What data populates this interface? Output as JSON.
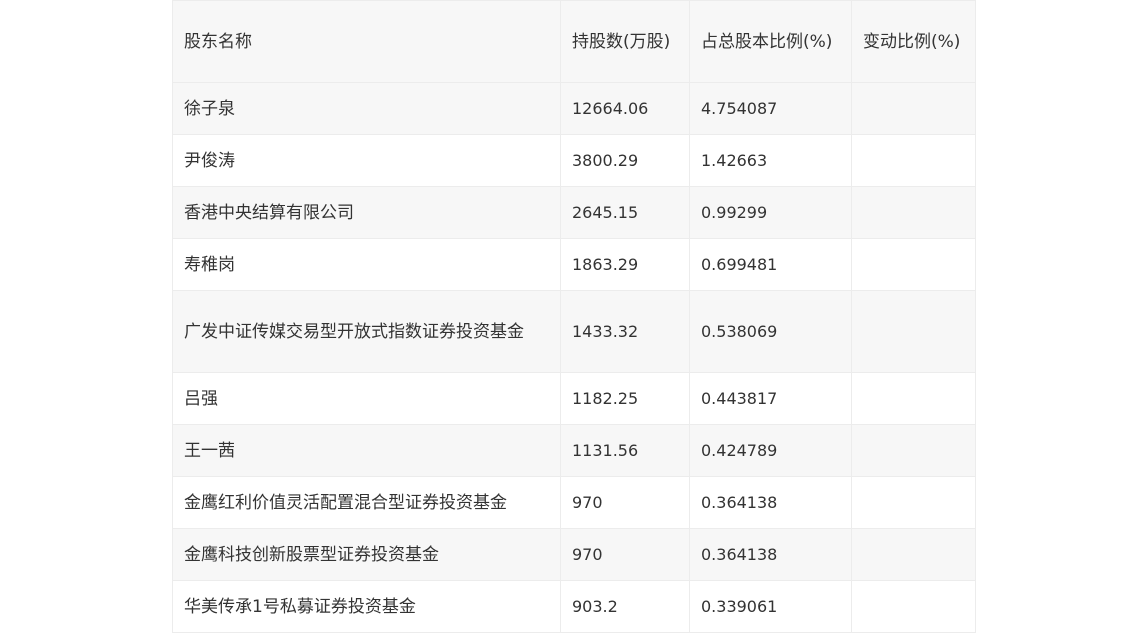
{
  "table": {
    "headers": [
      "股东名称",
      "持股数(万股)",
      "占总股本比例(%)",
      "变动比例(%)"
    ],
    "rows": [
      {
        "name": "徐子泉",
        "shares": "12664.06",
        "ratio": "4.754087",
        "change": ""
      },
      {
        "name": "尹俊涛",
        "shares": "3800.29",
        "ratio": "1.42663",
        "change": ""
      },
      {
        "name": "香港中央结算有限公司",
        "shares": "2645.15",
        "ratio": "0.99299",
        "change": ""
      },
      {
        "name": "寿稚岗",
        "shares": "1863.29",
        "ratio": "0.699481",
        "change": ""
      },
      {
        "name": "广发中证传媒交易型开放式指数证券投资基金",
        "shares": "1433.32",
        "ratio": "0.538069",
        "change": ""
      },
      {
        "name": "吕强",
        "shares": "1182.25",
        "ratio": "0.443817",
        "change": ""
      },
      {
        "name": "王一茜",
        "shares": "1131.56",
        "ratio": "0.424789",
        "change": ""
      },
      {
        "name": "金鹰红利价值灵活配置混合型证券投资基金",
        "shares": "970",
        "ratio": "0.364138",
        "change": ""
      },
      {
        "name": "金鹰科技创新股票型证券投资基金",
        "shares": "970",
        "ratio": "0.364138",
        "change": ""
      },
      {
        "name": "华美传承1号私募证券投资基金",
        "shares": "903.2",
        "ratio": "0.339061",
        "change": ""
      }
    ]
  }
}
